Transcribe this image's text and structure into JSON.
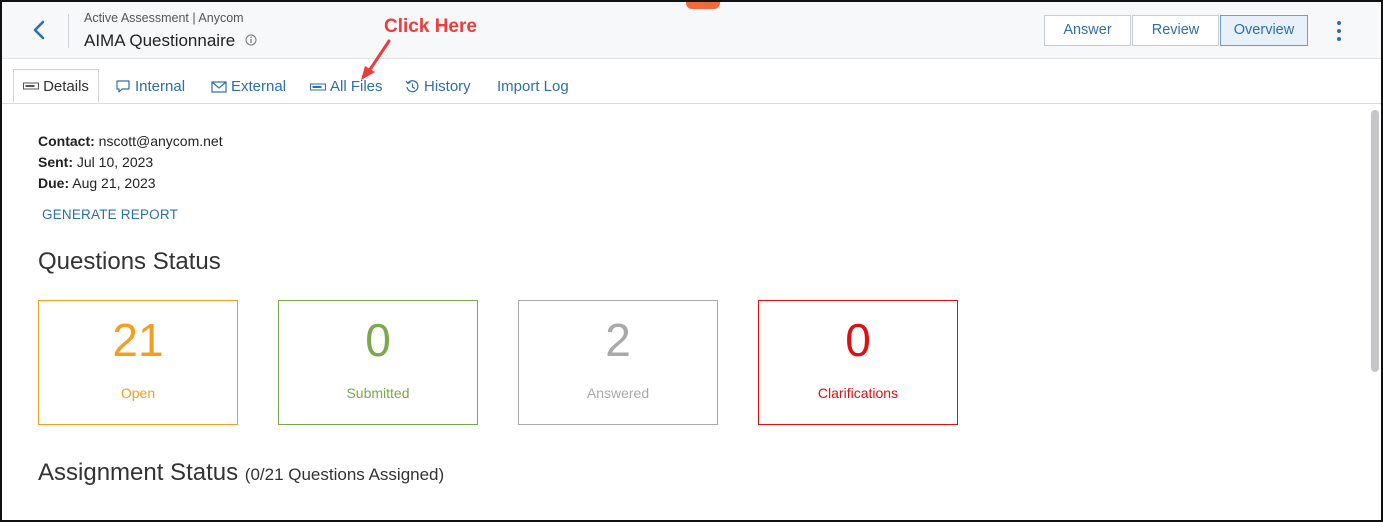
{
  "header": {
    "subtitle": "Active Assessment | Anycom",
    "title": "AIMA Questionnaire",
    "buttons": {
      "answer": "Answer",
      "review": "Review",
      "overview": "Overview"
    }
  },
  "tabs": [
    {
      "label": "Details"
    },
    {
      "label": "Internal"
    },
    {
      "label": "External"
    },
    {
      "label": "All Files"
    },
    {
      "label": "History"
    },
    {
      "label": "Import Log"
    }
  ],
  "annotation": {
    "text": "Click Here"
  },
  "details": {
    "contact_label": "Contact:",
    "contact_value": "nscott@anycom.net",
    "sent_label": "Sent:",
    "sent_value": "Jul 10, 2023",
    "due_label": "Due:",
    "due_value": "Aug 21, 2023",
    "generate_report": "GENERATE REPORT"
  },
  "questions_status": {
    "heading": "Questions Status",
    "cards": [
      {
        "value": "21",
        "label": "Open",
        "color": "#f0a020"
      },
      {
        "value": "0",
        "label": "Submitted",
        "color": "#7aa84a"
      },
      {
        "value": "2",
        "label": "Answered",
        "color": "#a9a9a9"
      },
      {
        "value": "0",
        "label": "Clarifications",
        "color": "#dd1111"
      }
    ]
  },
  "assignment_status": {
    "heading": "Assignment Status",
    "detail": "(0/21 Questions Assigned)"
  },
  "colors": {
    "accent": "#2e6fa8",
    "annotation": "#ee3b3b"
  }
}
